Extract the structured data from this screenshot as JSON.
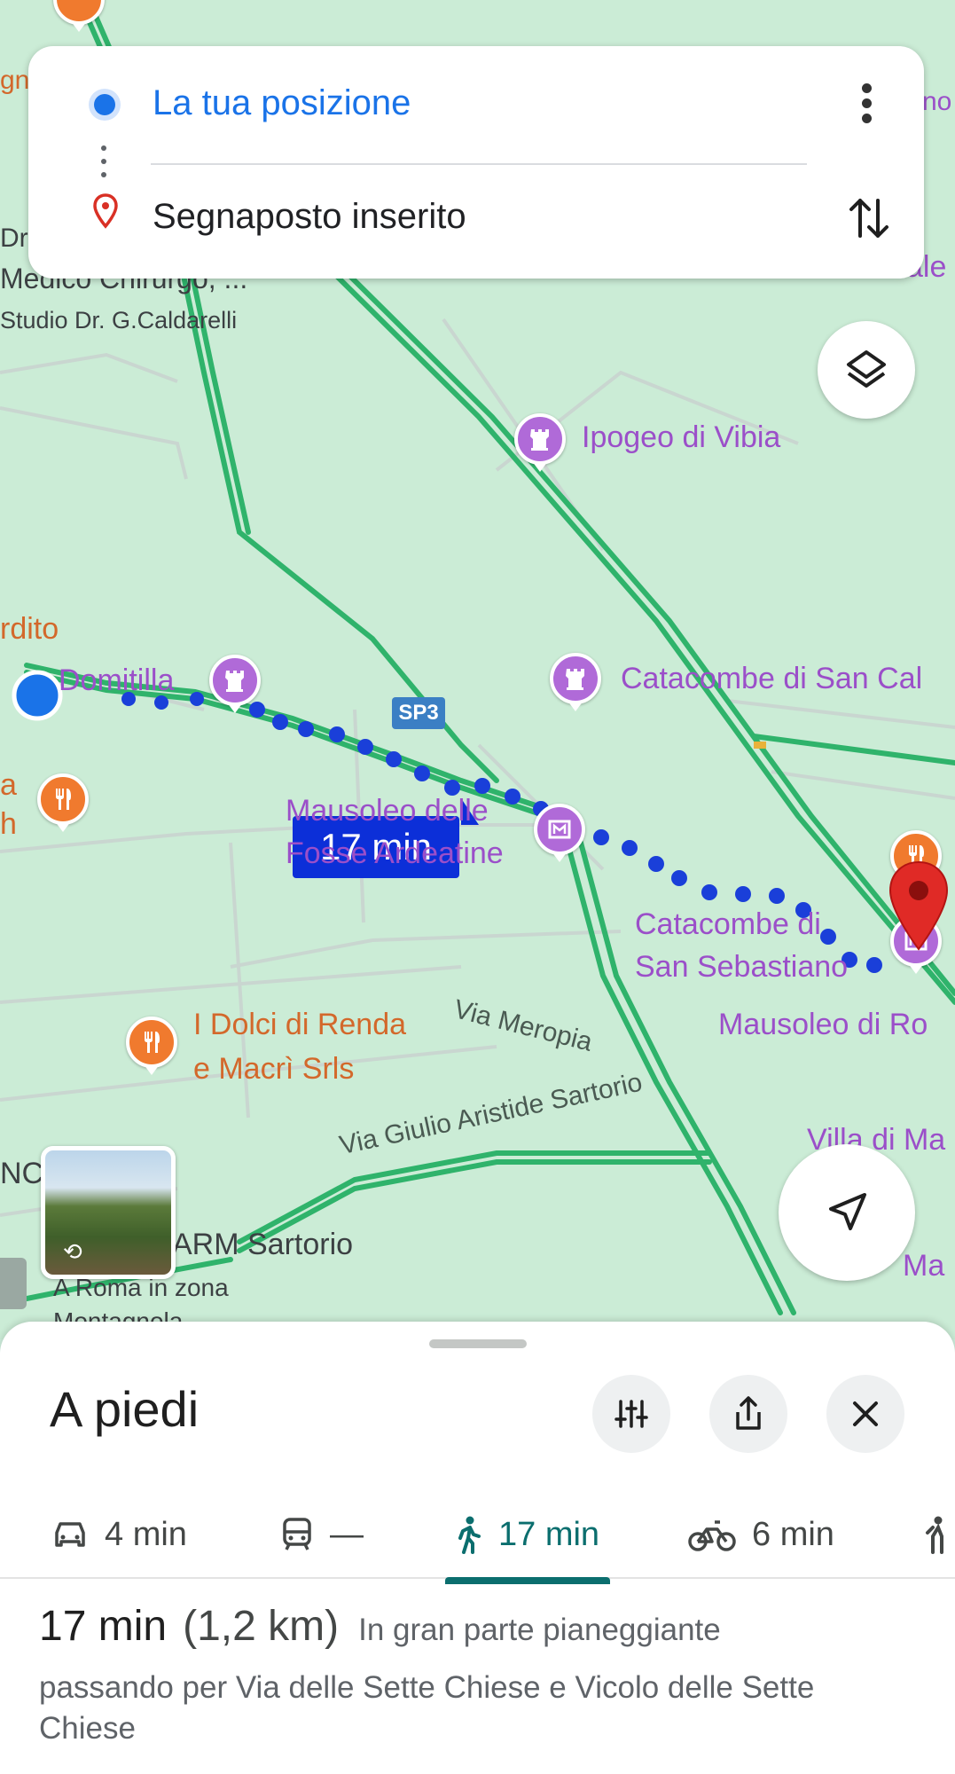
{
  "search": {
    "origin": "La tua posizione",
    "destination": "Segnaposto inserito"
  },
  "map": {
    "poi_labels": {
      "ipogeo": "Ipogeo di Vibia",
      "catacombe_callisto": "Catacombe di San Cal",
      "mausoleo_fosse": "Mausoleo delle Fosse Ardeatine",
      "catacombe_sebastiano": "Catacombe di\nSan Sebastiano",
      "mausoleo_ro": "Mausoleo di Ro",
      "dolci": "I Dolci di Renda\ne Macrì Srls",
      "domitilla": "Domitilla",
      "medico": "Medico Chirurgo, ...",
      "studio": "Studio Dr. G.Caldarelli",
      "dr": "Dr.",
      "rdito": "rdito",
      "gna": "gna",
      "villa": "Villa di Ma",
      "arm": "ARM Sartorio",
      "roma_zona": "A Roma in zona",
      "montagnola": "Montagnola",
      "ma": "Ma",
      "nc": "NC",
      "ale": "ale",
      "a": "a",
      "h": "h",
      "no": "no"
    },
    "street_labels": {
      "meropia": "Via Meropia",
      "sartorio": "Via Giulio Aristide Sartorio"
    },
    "road_badge": "SP3",
    "route_time": "17 min",
    "colors": {
      "route": "#1a3fd9",
      "road": "#2fb36b",
      "poi_purple": "#b06ad8",
      "poi_orange": "#f07a2e",
      "destination_pin": "#e02a26"
    }
  },
  "sheet": {
    "title": "A piedi",
    "modes": [
      {
        "icon": "car-icon",
        "label": "4 min"
      },
      {
        "icon": "transit-icon",
        "label": "—"
      },
      {
        "icon": "walk-icon",
        "label": "17 min",
        "active": true
      },
      {
        "icon": "bike-icon",
        "label": "6 min"
      }
    ],
    "summary": {
      "duration": "17 min",
      "distance": "(1,2 km)",
      "terrain": "In gran parte pianeggiante",
      "via": "passando per Via delle Sette Chiese e Vicolo delle Sette Chiese"
    }
  }
}
